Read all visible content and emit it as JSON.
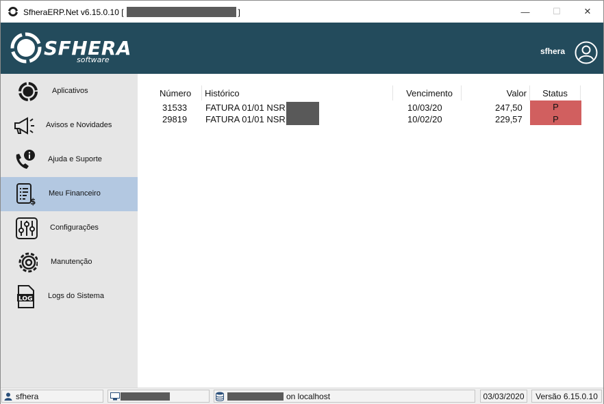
{
  "window": {
    "title_prefix": "SfheraERP.Net v6.15.0.10 [",
    "title_suffix": "]",
    "minimize_glyph": "—",
    "maximize_glyph": "☐",
    "close_glyph": "✕"
  },
  "header": {
    "logo_word": "SFHERA",
    "logo_sub": "software",
    "user_name": "sfhera",
    "user_icon": "user-circle-icon",
    "background": "#234b5c"
  },
  "sidebar": {
    "items": [
      {
        "label": "Aplicativos",
        "icon": "apps-ring-icon"
      },
      {
        "label": "Avisos e Novidades",
        "icon": "megaphone-icon"
      },
      {
        "label": "Ajuda e Suporte",
        "icon": "phone-info-icon"
      },
      {
        "label": "Meu Financeiro",
        "icon": "invoice-dollar-icon",
        "active": true
      },
      {
        "label": "Configurações",
        "icon": "sliders-icon"
      },
      {
        "label": "Manutenção",
        "icon": "gear-icon"
      },
      {
        "label": "Logs do Sistema",
        "icon": "log-file-icon"
      }
    ]
  },
  "table": {
    "headers": {
      "numero": "Número",
      "historico": "Histórico",
      "vencimento": "Vencimento",
      "valor": "Valor",
      "status": "Status"
    },
    "rows": [
      {
        "numero": "31533",
        "historico": "FATURA 01/01 NSR",
        "vencimento": "10/03/20",
        "valor": "247,50",
        "status": "P"
      },
      {
        "numero": "29819",
        "historico": "FATURA 01/01 NSR",
        "vencimento": "10/02/20",
        "valor": "229,57",
        "status": "P"
      }
    ],
    "status_color": "#d15f5f"
  },
  "statusbar": {
    "user": "sfhera",
    "db_suffix": "on localhost",
    "date": "03/03/2020",
    "version": "Versão 6.15.0.10"
  }
}
